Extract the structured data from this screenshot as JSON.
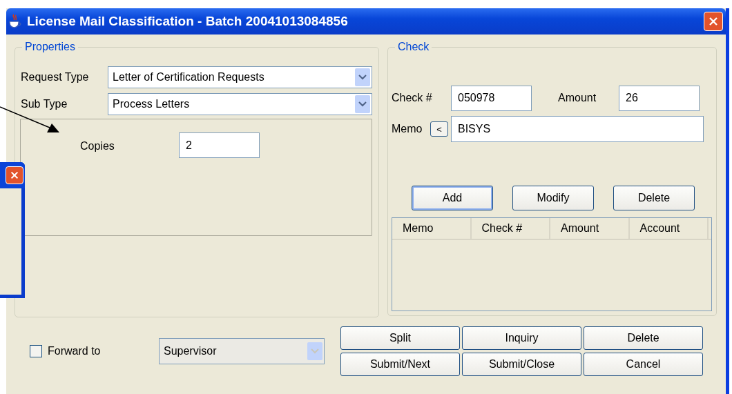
{
  "window": {
    "title": "License Mail Classification - Batch 20041013084856"
  },
  "properties": {
    "legend": "Properties",
    "request_type": {
      "label": "Request Type",
      "value": "Letter of Certification Requests"
    },
    "sub_type": {
      "label": "Sub Type",
      "value": "Process Letters"
    },
    "copies": {
      "label": "Copies",
      "value": "2"
    }
  },
  "check": {
    "legend": "Check",
    "check_number": {
      "label": "Check #",
      "value": "050978"
    },
    "amount": {
      "label": "Amount",
      "value": "26"
    },
    "memo": {
      "label": "Memo",
      "button": "<",
      "value": "BISYS"
    },
    "buttons": [
      {
        "label": "Add",
        "focused": true
      },
      {
        "label": "Modify",
        "focused": false
      },
      {
        "label": "Delete",
        "focused": false
      }
    ],
    "table": {
      "columns": [
        "Memo",
        "Check #",
        "Amount",
        "Account"
      ]
    }
  },
  "forward": {
    "label": "Forward to",
    "checked": false,
    "value": "Supervisor",
    "disabled": true
  },
  "buttons": [
    "Split",
    "Inquiry",
    "Delete",
    "Submit/Next",
    "Submit/Close",
    "Cancel"
  ]
}
